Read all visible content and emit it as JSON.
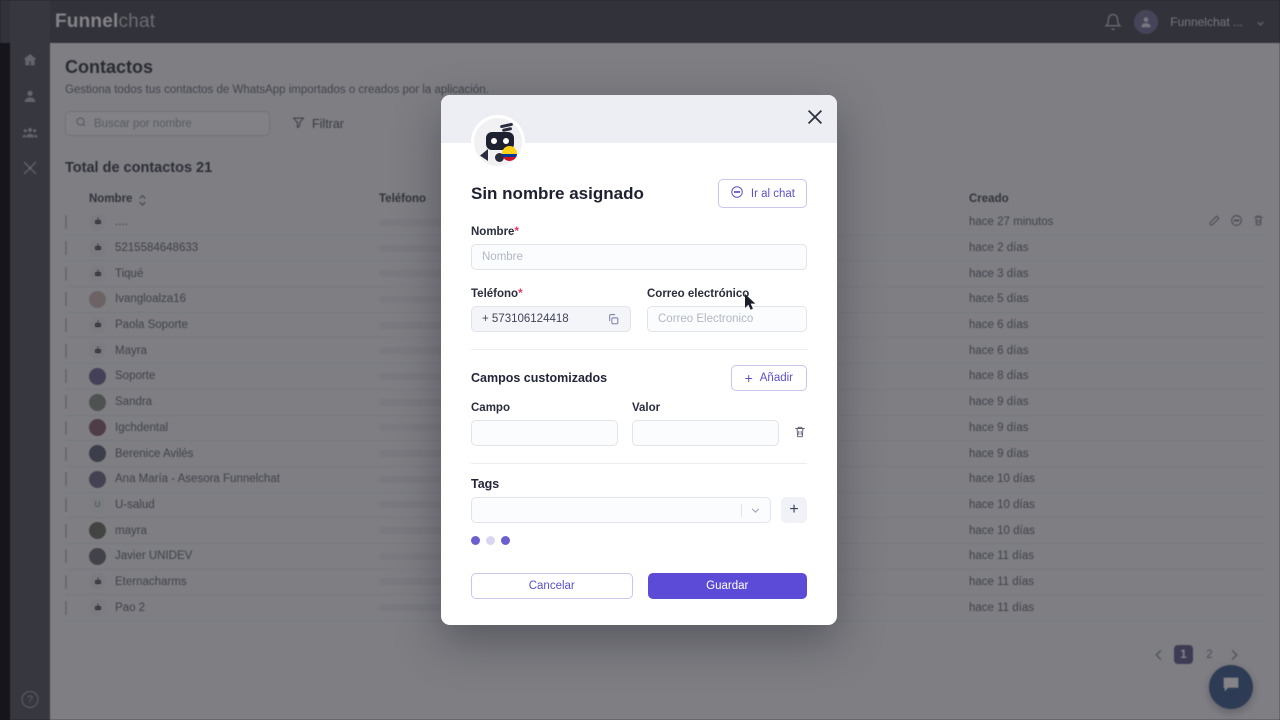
{
  "topbar": {
    "brand_bold": "Funnel",
    "brand_light": "chat",
    "account_name": "Funnelchat ...",
    "bell_icon": "bell-icon",
    "chevron_icon": "chevron-down-icon"
  },
  "sidebar": {
    "items": [
      {
        "icon": "home-icon",
        "name": "home"
      },
      {
        "icon": "user-icon",
        "name": "contacts"
      },
      {
        "icon": "group-icon",
        "name": "teams"
      },
      {
        "icon": "tools-icon",
        "name": "tools"
      }
    ],
    "help_label": "?"
  },
  "page": {
    "title": "Contactos",
    "subtitle": "Gestiona todos tus contactos de WhatsApp importados o creados por la aplicación.",
    "total_label": "Total de contactos 21"
  },
  "search": {
    "placeholder": "Buscar por nombre",
    "icon": "search-icon"
  },
  "filter": {
    "label": "Filtrar",
    "icon": "filter-icon"
  },
  "table": {
    "columns": [
      "Nombre",
      "Teléfono",
      "Creado"
    ],
    "rows": [
      {
        "name": "....",
        "created": "hace 27 minutos",
        "avatar": "bot",
        "checkbox": true
      },
      {
        "name": "5215584648633",
        "created": "hace 2 días",
        "avatar": "bot",
        "checkbox": true
      },
      {
        "name": "Tiqué",
        "created": "hace 3 días",
        "avatar": "bot",
        "checkbox": true
      },
      {
        "name": "Ivangloalza16",
        "created": "hace 5 días",
        "avatar": "photo-peach",
        "checkbox": true
      },
      {
        "name": "Paola Soporte",
        "created": "hace 6 días",
        "avatar": "bot",
        "checkbox": true
      },
      {
        "name": "Mayra",
        "created": "hace 6 días",
        "avatar": "bot",
        "checkbox": true
      },
      {
        "name": "Soporte",
        "created": "hace 8 días",
        "avatar": "solid-purple",
        "checkbox": true
      },
      {
        "name": "Sandra",
        "created": "hace 9 días",
        "avatar": "photo-green",
        "checkbox": true
      },
      {
        "name": "Igchdental",
        "created": "hace 9 días",
        "avatar": "photo-red",
        "checkbox": true
      },
      {
        "name": "Berenice Avilés",
        "created": "hace 9 días",
        "avatar": "solid-blue",
        "checkbox": true
      },
      {
        "name": "Ana María - Asesora Funnelchat",
        "created": "hace 10 días",
        "avatar": "photo-violet",
        "checkbox": true
      },
      {
        "name": "U-salud",
        "created": "hace 10 días",
        "avatar": "letter-u",
        "checkbox": true
      },
      {
        "name": "mayra",
        "created": "hace 10 días",
        "avatar": "photo-olive",
        "checkbox": true
      },
      {
        "name": "Javier UNIDEV",
        "created": "hace 11 días",
        "avatar": "photo-gray",
        "checkbox": true
      },
      {
        "name": "Eternacharms",
        "created": "hace 11 días",
        "avatar": "bot",
        "checkbox": true
      },
      {
        "name": "Pao 2",
        "created": "hace 11 días",
        "avatar": "bot",
        "checkbox": true
      }
    ],
    "row_actions": [
      "edit-icon",
      "chat-icon",
      "trash-icon"
    ],
    "sort_icon": "sort-icon"
  },
  "pagination": {
    "prev_icon": "chevron-left-icon",
    "next_icon": "chevron-right-icon",
    "pages": [
      "1",
      "2"
    ],
    "active_page": "1"
  },
  "fab": {
    "icon": "chat-bubble-icon"
  },
  "modal": {
    "close_icon": "close-icon",
    "avatar_name": "bot-avatar",
    "title": "Sin nombre asignado",
    "go_to_chat": {
      "label": "Ir al chat",
      "icon": "chat-bubble-icon"
    },
    "name_field": {
      "label": "Nombre",
      "required": "*",
      "placeholder": "Nombre",
      "value": ""
    },
    "phone_field": {
      "label": "Teléfono",
      "required": "*",
      "value": "+ 573106124418",
      "copy_icon": "copy-icon"
    },
    "email_field": {
      "label": "Correo electrónico",
      "placeholder": "Correo Electronico",
      "value": ""
    },
    "custom_fields": {
      "title": "Campos customizados",
      "add_label": "Añadir",
      "add_icon": "plus-icon",
      "field_label": "Campo",
      "value_label": "Valor",
      "field_value": "",
      "value_value": "",
      "delete_icon": "trash-icon"
    },
    "tags": {
      "label": "Tags",
      "value": "",
      "dropdown_icon": "chevron-down-icon",
      "add_icon": "plus-icon"
    },
    "loading_dots": 3,
    "cancel_label": "Cancelar",
    "save_label": "Guardar"
  },
  "colors": {
    "accent_purple": "#5b4bd6",
    "topbar": "#4d5161",
    "rail": "#545a6b",
    "required_red": "#e8365d",
    "fab_blue": "#1668e3",
    "logo_green": "#6cbf7a"
  }
}
